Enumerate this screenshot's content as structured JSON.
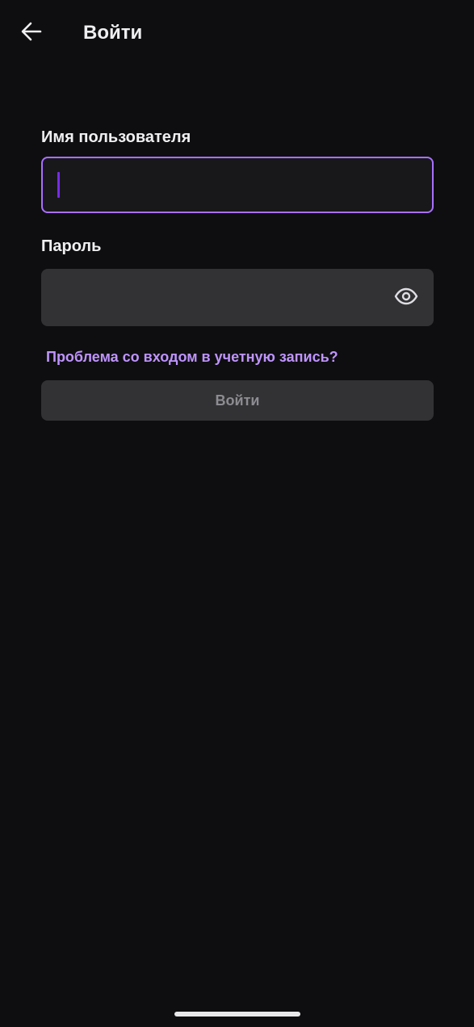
{
  "header": {
    "back_icon": "arrow-left-icon",
    "title": "Войти"
  },
  "form": {
    "username": {
      "label": "Имя пользователя",
      "value": "",
      "focused": true
    },
    "password": {
      "label": "Пароль",
      "value": "",
      "visibility_icon": "eye-icon"
    },
    "trouble_link": "Проблема со входом в учетную запись?",
    "submit_label": "Войти",
    "submit_enabled": false
  },
  "colors": {
    "background": "#0e0e10",
    "accent": "#a970ff",
    "link": "#bf94ff",
    "caret": "#772ce8",
    "field_background": "#323235"
  }
}
